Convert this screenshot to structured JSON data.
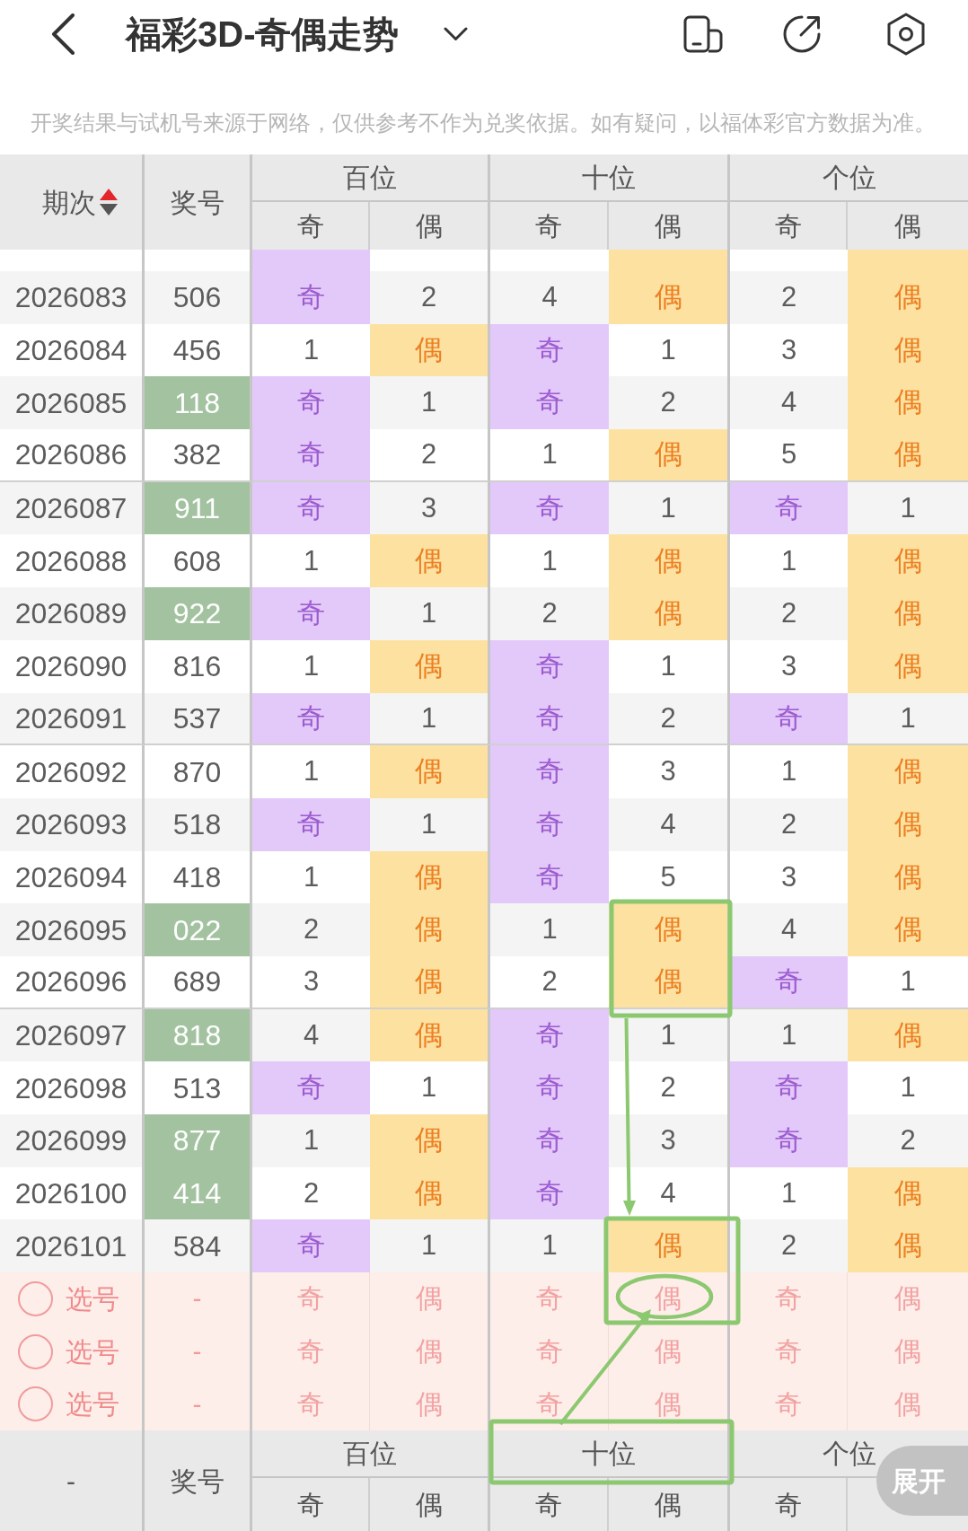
{
  "top_bar": {
    "title": "福彩3D-奇偶走势"
  },
  "notice": "开奖结果与试机号来源于网络，仅供参考不作为兑奖依据。如有疑问，以福体彩官方数据为准。",
  "table": {
    "header": {
      "period": "期次",
      "sort_ascending": true,
      "number": "奖号",
      "positions": [
        {
          "label": "百位",
          "sub": [
            "奇",
            "偶"
          ]
        },
        {
          "label": "十位",
          "sub": [
            "奇",
            "偶"
          ]
        },
        {
          "label": "个位",
          "sub": [
            "奇",
            "偶"
          ]
        }
      ]
    },
    "partial_row": {
      "cells": [
        {
          "hit": true
        },
        {
          "hit": false
        },
        {
          "hit": false
        },
        {
          "hit": true
        },
        {
          "hit": false
        },
        {
          "hit": true
        }
      ]
    },
    "groups": [
      {
        "rows": [
          {
            "period": "2026083",
            "number": "506",
            "highlighted": false,
            "cells": [
              {
                "text": "奇",
                "hit": true
              },
              {
                "text": "2",
                "hit": false
              },
              {
                "text": "4",
                "hit": false
              },
              {
                "text": "偶",
                "hit": true
              },
              {
                "text": "2",
                "hit": false
              },
              {
                "text": "偶",
                "hit": true
              }
            ]
          },
          {
            "period": "2026084",
            "number": "456",
            "highlighted": false,
            "cells": [
              {
                "text": "1",
                "hit": false
              },
              {
                "text": "偶",
                "hit": true
              },
              {
                "text": "奇",
                "hit": true
              },
              {
                "text": "1",
                "hit": false
              },
              {
                "text": "3",
                "hit": false
              },
              {
                "text": "偶",
                "hit": true
              }
            ]
          },
          {
            "period": "2026085",
            "number": "118",
            "highlighted": true,
            "cells": [
              {
                "text": "奇",
                "hit": true
              },
              {
                "text": "1",
                "hit": false
              },
              {
                "text": "奇",
                "hit": true
              },
              {
                "text": "2",
                "hit": false
              },
              {
                "text": "4",
                "hit": false
              },
              {
                "text": "偶",
                "hit": true
              }
            ]
          },
          {
            "period": "2026086",
            "number": "382",
            "highlighted": false,
            "cells": [
              {
                "text": "奇",
                "hit": true
              },
              {
                "text": "2",
                "hit": false
              },
              {
                "text": "1",
                "hit": false
              },
              {
                "text": "偶",
                "hit": true
              },
              {
                "text": "5",
                "hit": false
              },
              {
                "text": "偶",
                "hit": true
              }
            ]
          }
        ]
      },
      {
        "rows": [
          {
            "period": "2026087",
            "number": "911",
            "highlighted": true,
            "cells": [
              {
                "text": "奇",
                "hit": true
              },
              {
                "text": "3",
                "hit": false
              },
              {
                "text": "奇",
                "hit": true
              },
              {
                "text": "1",
                "hit": false
              },
              {
                "text": "奇",
                "hit": true
              },
              {
                "text": "1",
                "hit": false
              }
            ]
          },
          {
            "period": "2026088",
            "number": "608",
            "highlighted": false,
            "cells": [
              {
                "text": "1",
                "hit": false
              },
              {
                "text": "偶",
                "hit": true
              },
              {
                "text": "1",
                "hit": false
              },
              {
                "text": "偶",
                "hit": true
              },
              {
                "text": "1",
                "hit": false
              },
              {
                "text": "偶",
                "hit": true
              }
            ]
          },
          {
            "period": "2026089",
            "number": "922",
            "highlighted": true,
            "cells": [
              {
                "text": "奇",
                "hit": true
              },
              {
                "text": "1",
                "hit": false
              },
              {
                "text": "2",
                "hit": false
              },
              {
                "text": "偶",
                "hit": true
              },
              {
                "text": "2",
                "hit": false
              },
              {
                "text": "偶",
                "hit": true
              }
            ]
          },
          {
            "period": "2026090",
            "number": "816",
            "highlighted": false,
            "cells": [
              {
                "text": "1",
                "hit": false
              },
              {
                "text": "偶",
                "hit": true
              },
              {
                "text": "奇",
                "hit": true
              },
              {
                "text": "1",
                "hit": false
              },
              {
                "text": "3",
                "hit": false
              },
              {
                "text": "偶",
                "hit": true
              }
            ]
          },
          {
            "period": "2026091",
            "number": "537",
            "highlighted": false,
            "cells": [
              {
                "text": "奇",
                "hit": true
              },
              {
                "text": "1",
                "hit": false
              },
              {
                "text": "奇",
                "hit": true
              },
              {
                "text": "2",
                "hit": false
              },
              {
                "text": "奇",
                "hit": true
              },
              {
                "text": "1",
                "hit": false
              }
            ]
          }
        ]
      },
      {
        "rows": [
          {
            "period": "2026092",
            "number": "870",
            "highlighted": false,
            "cells": [
              {
                "text": "1",
                "hit": false
              },
              {
                "text": "偶",
                "hit": true
              },
              {
                "text": "奇",
                "hit": true
              },
              {
                "text": "3",
                "hit": false
              },
              {
                "text": "1",
                "hit": false
              },
              {
                "text": "偶",
                "hit": true
              }
            ]
          },
          {
            "period": "2026093",
            "number": "518",
            "highlighted": false,
            "cells": [
              {
                "text": "奇",
                "hit": true
              },
              {
                "text": "1",
                "hit": false
              },
              {
                "text": "奇",
                "hit": true
              },
              {
                "text": "4",
                "hit": false
              },
              {
                "text": "2",
                "hit": false
              },
              {
                "text": "偶",
                "hit": true
              }
            ]
          },
          {
            "period": "2026094",
            "number": "418",
            "highlighted": false,
            "cells": [
              {
                "text": "1",
                "hit": false
              },
              {
                "text": "偶",
                "hit": true
              },
              {
                "text": "奇",
                "hit": true
              },
              {
                "text": "5",
                "hit": false
              },
              {
                "text": "3",
                "hit": false
              },
              {
                "text": "偶",
                "hit": true
              }
            ]
          },
          {
            "period": "2026095",
            "number": "022",
            "highlighted": true,
            "cells": [
              {
                "text": "2",
                "hit": false
              },
              {
                "text": "偶",
                "hit": true
              },
              {
                "text": "1",
                "hit": false
              },
              {
                "text": "偶",
                "hit": true
              },
              {
                "text": "4",
                "hit": false
              },
              {
                "text": "偶",
                "hit": true
              }
            ]
          },
          {
            "period": "2026096",
            "number": "689",
            "highlighted": false,
            "cells": [
              {
                "text": "3",
                "hit": false
              },
              {
                "text": "偶",
                "hit": true
              },
              {
                "text": "2",
                "hit": false
              },
              {
                "text": "偶",
                "hit": true
              },
              {
                "text": "奇",
                "hit": true
              },
              {
                "text": "1",
                "hit": false
              }
            ]
          }
        ]
      },
      {
        "rows": [
          {
            "period": "2026097",
            "number": "818",
            "highlighted": true,
            "cells": [
              {
                "text": "4",
                "hit": false
              },
              {
                "text": "偶",
                "hit": true
              },
              {
                "text": "奇",
                "hit": true
              },
              {
                "text": "1",
                "hit": false
              },
              {
                "text": "1",
                "hit": false
              },
              {
                "text": "偶",
                "hit": true
              }
            ]
          },
          {
            "period": "2026098",
            "number": "513",
            "highlighted": false,
            "cells": [
              {
                "text": "奇",
                "hit": true
              },
              {
                "text": "1",
                "hit": false
              },
              {
                "text": "奇",
                "hit": true
              },
              {
                "text": "2",
                "hit": false
              },
              {
                "text": "奇",
                "hit": true
              },
              {
                "text": "1",
                "hit": false
              }
            ]
          },
          {
            "period": "2026099",
            "number": "877",
            "highlighted": true,
            "cells": [
              {
                "text": "1",
                "hit": false
              },
              {
                "text": "偶",
                "hit": true
              },
              {
                "text": "奇",
                "hit": true
              },
              {
                "text": "3",
                "hit": false
              },
              {
                "text": "奇",
                "hit": true
              },
              {
                "text": "2",
                "hit": false
              }
            ]
          },
          {
            "period": "2026100",
            "number": "414",
            "highlighted": true,
            "cells": [
              {
                "text": "2",
                "hit": false
              },
              {
                "text": "偶",
                "hit": true
              },
              {
                "text": "奇",
                "hit": true
              },
              {
                "text": "4",
                "hit": false
              },
              {
                "text": "1",
                "hit": false
              },
              {
                "text": "偶",
                "hit": true
              }
            ]
          },
          {
            "period": "2026101",
            "number": "584",
            "highlighted": false,
            "cells": [
              {
                "text": "奇",
                "hit": true
              },
              {
                "text": "1",
                "hit": false
              },
              {
                "text": "1",
                "hit": false
              },
              {
                "text": "偶",
                "hit": true
              },
              {
                "text": "2",
                "hit": false
              },
              {
                "text": "偶",
                "hit": true
              }
            ]
          }
        ]
      }
    ],
    "pick_rows": [
      {
        "checked": false,
        "label": "选号",
        "number": "-",
        "options": [
          {
            "text": "奇",
            "selected": false
          },
          {
            "text": "偶",
            "selected": false
          },
          {
            "text": "奇",
            "selected": false
          },
          {
            "text": "偶",
            "selected": false
          },
          {
            "text": "奇",
            "selected": false
          },
          {
            "text": "偶",
            "selected": false
          }
        ]
      },
      {
        "checked": false,
        "label": "选号",
        "number": "-",
        "options": [
          {
            "text": "奇",
            "selected": false
          },
          {
            "text": "偶",
            "selected": false
          },
          {
            "text": "奇",
            "selected": false
          },
          {
            "text": "偶",
            "selected": false
          },
          {
            "text": "奇",
            "selected": false
          },
          {
            "text": "偶",
            "selected": false
          }
        ]
      },
      {
        "checked": false,
        "label": "选号",
        "number": "-",
        "options": [
          {
            "text": "奇",
            "selected": false
          },
          {
            "text": "偶",
            "selected": false
          },
          {
            "text": "奇",
            "selected": false
          },
          {
            "text": "偶",
            "selected": false
          },
          {
            "text": "奇",
            "selected": false
          },
          {
            "text": "偶",
            "selected": false
          }
        ]
      }
    ],
    "footer": {
      "period": "-",
      "number": "奖号",
      "positions": [
        {
          "label": "百位",
          "sub": [
            "奇",
            "偶"
          ]
        },
        {
          "label": "十位",
          "sub": [
            "奇",
            "偶"
          ]
        },
        {
          "label": "个位",
          "sub": [
            "奇"
          ]
        }
      ]
    }
  },
  "expand_button": {
    "label": "展开"
  }
}
